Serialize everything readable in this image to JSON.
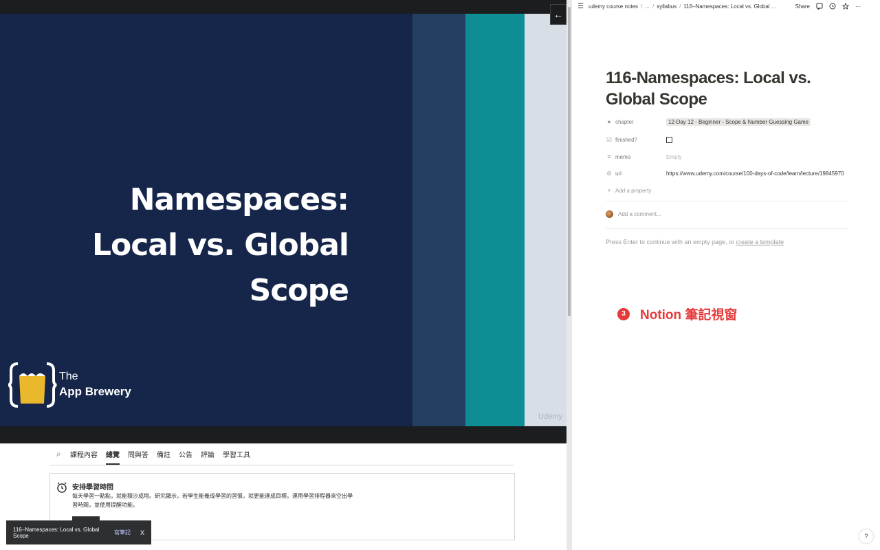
{
  "video": {
    "slide_title_line1": "Namespaces:",
    "slide_title_line2": "Local vs. Global Scope",
    "brand_line1": "The",
    "brand_line2": "App Brewery",
    "watermark": "Udemy",
    "back_icon": "arrow-left-icon"
  },
  "tabs": {
    "items": [
      "課程內容",
      "總覽",
      "問與答",
      "備註",
      "公告",
      "評論",
      "學習工具"
    ],
    "active": "總覽"
  },
  "schedule_card": {
    "title": "安排學習時間",
    "body": "每天學習一點點，就能積沙成塔。研究顯示，若學生能養成學習的習慣，就更能達成目標。運用學習排程器來空出學習時間，並使用提醒功能。"
  },
  "toast": {
    "title": "116–Namespaces: Local vs. Global Scope",
    "link": "寫筆記",
    "close": "X"
  },
  "notion": {
    "breadcrumb": [
      "udemy course notes",
      "...",
      "syllabus",
      "116–Namespaces: Local vs. Global ..."
    ],
    "share": "Share",
    "page_title": "116-Namespaces: Local vs. Global Scope",
    "properties": {
      "chapter_label": "chapter",
      "chapter_value": "12-Day 12 - Beginner - Scope & Number Guessing Game",
      "finished_label": "finished?",
      "memo_label": "memo",
      "memo_value": "Empty",
      "url_label": "url",
      "url_value": "https://www.udemy.com/course/100-days-of-code/learn/lecture/19845970",
      "add_property": "Add a property"
    },
    "comment_placeholder": "Add a comment...",
    "hint_prefix": "Press Enter to continue with an empty page, or ",
    "hint_link": "create a template",
    "help": "?"
  },
  "annotation": {
    "number": "3",
    "text": "Notion 筆記視窗",
    "color": "#e43a3a"
  }
}
